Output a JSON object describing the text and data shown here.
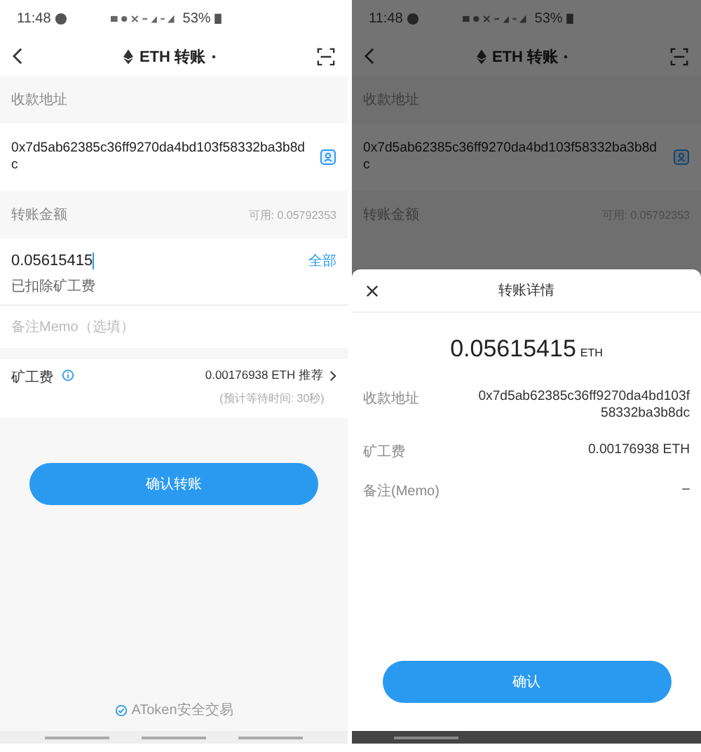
{
  "left_screen": {
    "status_bar": {
      "time": "11:48",
      "battery": "53%"
    },
    "header": {
      "title": "ETH 转账"
    },
    "recipient_label": "收款地址",
    "address": "0x7d5ab62385c36ff9270da4bd103f58332ba3b8dc",
    "amount_label": "转账金额",
    "available": "可用: 0.05792353",
    "amount_value": "0.05615415",
    "max_button": "全部",
    "fee_note": "已扣除矿工费",
    "memo_placeholder": "备注Memo（选填）",
    "fee_label": "矿工费",
    "fee_value": "0.00176938 ETH 推荐",
    "fee_time": "(预计等待时间: 30秒)",
    "confirm_button": "确认转账",
    "footer": "AToken安全交易"
  },
  "right_screen": {
    "status_bar": {
      "time": "11:48",
      "battery": "53%"
    },
    "header": {
      "title": "ETH 转账"
    },
    "recipient_label": "收款地址",
    "address": "0x7d5ab62385c36ff9270da4bd103f58332ba3b8dc",
    "amount_label": "转账金额",
    "available": "可用: 0.05792353",
    "sheet": {
      "title": "转账详情",
      "amount": "0.05615415",
      "unit": "ETH",
      "rows": [
        {
          "label": "收款地址",
          "value": "0x7d5ab62385c36ff9270da4bd103f58332ba3b8dc"
        },
        {
          "label": "矿工费",
          "value": "0.00176938 ETH"
        },
        {
          "label": "备注(Memo)",
          "value": "–"
        }
      ],
      "confirm_button": "确认"
    }
  }
}
